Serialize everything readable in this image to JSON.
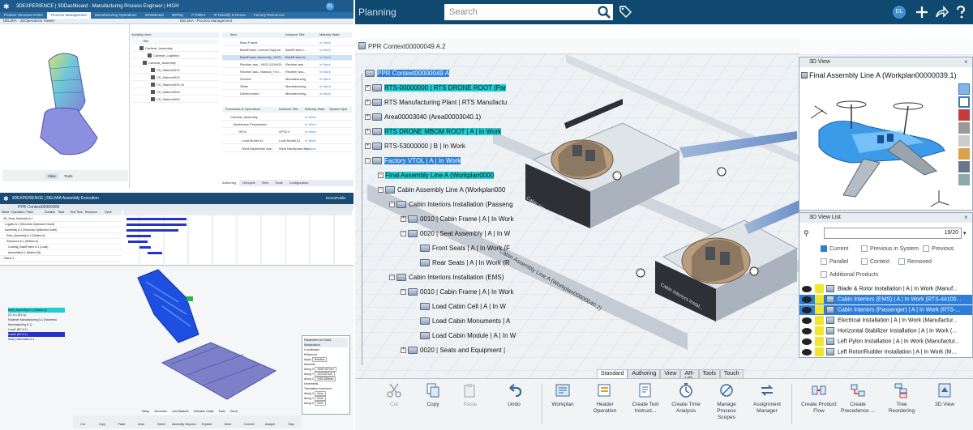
{
  "left_collage": {
    "top_app": {
      "title": "3DEXPERIENCE | 3DDashboard - Manufacturing Process Engineer | HIGH",
      "tabs": [
        "Product Structure Editor",
        "Process Management",
        "Manufacturing Operations",
        "3DWebcast",
        "3DPlay",
        "P-FMEA",
        "IP Classify & Reuse",
        "Factory Resources"
      ],
      "active_tab": 1,
      "panes": [
        "DELMIA - 3DOperations Viewer",
        "DELMIA - Process Management"
      ],
      "avatar": "DL",
      "view_tabs": [
        "View",
        "Tools"
      ],
      "table_tabs": [
        "Authoring",
        "Lifecycle",
        "View",
        "Tools",
        "Configuration"
      ],
      "tree_header": "Auxiliary view",
      "tree_col": "Title",
      "tree": [
        "Carbeat_Assembly",
        "Carbeat_Logistics",
        "Carbeat_Assembly",
        "C5_Station0010",
        "C5_Station0020",
        "C5_Station0030 v4",
        "C5_Station0040",
        "C5_Station0050"
      ],
      "grid_cols": [
        "Item",
        "Instance Title",
        "Maturity State"
      ],
      "grid_rows": [
        [
          "Back Frame",
          "",
          "In Work"
        ],
        [
          "BackFrame Lumbar Support",
          "BackFrame L...",
          "In Work"
        ],
        [
          "BackFrame Assembly_YAGI...",
          "BackFrame A...",
          "In Work"
        ],
        [
          "Recliner ass...YAGI-1110400...",
          "Recliner ass...",
          "In Work"
        ],
        [
          "Recliner ass...Manual_YGI...",
          "Recliner ass...",
          "In Work"
        ],
        [
          "Shooter",
          "Manufacturing",
          "In Work"
        ],
        [
          "Slider",
          "Manufacturing",
          "In Work"
        ],
        [
          "Dishmounted",
          "Manufacturing",
          "In Work"
        ]
      ],
      "ops_cols": [
        "Processes & Operations",
        "Instance Title",
        "Maturity State",
        "System Upd"
      ],
      "ops_rows": [
        [
          "Carbeat_Assembly",
          "",
          "In Work"
        ],
        [
          "Backframe Preparation",
          "",
          "In Work"
        ],
        [
          "OP10",
          "OP10.0",
          "In Work"
        ],
        [
          "Load Model A1",
          "Load Model A1",
          "In Work"
        ],
        [
          "Weld Backframe Ass...",
          "Weld Backframe Ass...",
          "In Work"
        ]
      ]
    },
    "bottom_app": {
      "title": "3DEXPERIENCE | DELMIA Assembly Execution",
      "context": "PPR Context00000009",
      "user": "DemoPublic",
      "grid_cols": [
        "Name / Operation / Plant",
        "Duration",
        "Start",
        "End Time",
        "Resource",
        "Cycle"
      ],
      "rows": [
        "3D_Seat_Assembly A.1",
        "Logistic A.1 (Seconds Optimized Gantt)",
        "Assembly A.1 (Seconds Optimized Gantt)",
        "Seat_Assembly A.1 (Station A)",
        "Sequence A.1 (Station A)",
        "Loading_BackFrame A.1 (Load)",
        "Assemble(A.1 (Station B))",
        "Total A.1"
      ],
      "tree": [
        "Seat_Assembly A.1 (Station A)",
        "SC A.1 (BV A)",
        "Fastener Manufacturing A.1 (Fastened Manufacturing A.1)",
        "Load1 (BV A.1)",
        "Load2 (BV A.1)",
        "Seat_Fabrication A.1"
      ],
      "robot_panel": {
        "title": "Parameters for Robot Manipulation",
        "sections": [
          "Coordinates",
          "Reference",
          "Apply",
          "Absolute",
          "Increments"
        ],
        "apply_value": "Relative",
        "fields": [
          [
            "Along X",
            "1535.097mm"
          ],
          [
            "Along Y",
            "1219.87mm"
          ],
          [
            "Along Z",
            "1952.889mm"
          ],
          [
            "Along X",
            "0mm"
          ],
          [
            "Along Y",
            "0mm"
          ],
          [
            "Along Z",
            "0mm"
          ]
        ],
        "translation_label": "Translation Increment"
      },
      "bottom_tabs": [
        "Setup",
        "Simulation",
        "Line Balance",
        "Selection Guide",
        "Tools",
        "Touch"
      ],
      "bottom_tools": [
        "Cut",
        "Copy",
        "Paste",
        "Undo",
        "Select",
        "Assembly Sequence",
        "Explode",
        "Move",
        "Connect",
        "Analyze",
        "Stop"
      ]
    }
  },
  "right_app": {
    "title": "Planning",
    "search_placeholder": "Search",
    "avatar": "DL",
    "ppr_title": "PPR Context00000049 A.2",
    "tree": [
      {
        "label": "PPR Context00000049 A",
        "hl": "blue"
      },
      {
        "label": "RTS-00000000 | RTS DRONE ROOT (Par",
        "hl": "cyan"
      },
      {
        "label": "RTS Manufacturing Plant | RTS Manufactu",
        "hl": ""
      },
      {
        "label": "Area00003040 (Area00003040.1)",
        "hl": ""
      },
      {
        "label": "RTS DRONE MBOM ROOT | A | In Work",
        "hl": "cyan"
      },
      {
        "label": "RTS-53000000 | B | In Work",
        "hl": ""
      },
      {
        "label": "Factory VTOL | A | In Work",
        "hl": "blue"
      },
      {
        "label": "Final Assembly Line A (Workplan0000",
        "hl": "cyan"
      },
      {
        "label": "Cabin Assembly Line A (Workplan000",
        "hl": ""
      },
      {
        "label": "Cabin Interiors Installation (Passeng",
        "hl": ""
      },
      {
        "label": "0010 | Cabin Frame | A | In Work",
        "hl": ""
      },
      {
        "label": "0020 | Seat Assembly | A | In W",
        "hl": ""
      },
      {
        "label": "Front Seats | A | In Work (F",
        "hl": ""
      },
      {
        "label": "Rear Seats | A | In Work (R",
        "hl": ""
      },
      {
        "label": "Cabin Interiors Installation (EMS)",
        "hl": ""
      },
      {
        "label": "0010 | Cabin Frame | A | In Work",
        "hl": ""
      },
      {
        "label": "Load Cabin Cell | A | In W",
        "hl": ""
      },
      {
        "label": "Load Cabin Monuments | A",
        "hl": ""
      },
      {
        "label": "Load Cabin Module | A | In W",
        "hl": ""
      },
      {
        "label": "0020 | Seats and Equipment |",
        "hl": ""
      }
    ],
    "floor_labels": [
      "Cabin Interiors Instal...",
      "Cabin Interiors Instal...",
      "Cabin Assembly Line A (Workplan00000040.2)"
    ],
    "view3d": {
      "header": "3D View",
      "title": "Final Assembly Line A (Workplan00000039.1)"
    },
    "view_list": {
      "header": "3D View List",
      "counter": "19/20",
      "options": [
        {
          "label": "Current",
          "checked": true
        },
        {
          "label": "Previous in System",
          "checked": false
        },
        {
          "label": "Previous",
          "checked": false
        },
        {
          "label": "Parallel",
          "checked": false
        },
        {
          "label": "Context",
          "checked": false
        },
        {
          "label": "Removed",
          "checked": false
        },
        {
          "label": "Additional Products",
          "checked": false
        }
      ],
      "rows": [
        {
          "label": "Blade & Rotor Installation | A | In Work (Manuf...",
          "selected": false
        },
        {
          "label": "Cabin Interiors (EMS) | A | In Work (RTS-44100...",
          "selected": true
        },
        {
          "label": "Cabin Interiors (Passenger) | A | In Work (RTS-...",
          "selected": true
        },
        {
          "label": "Electrical Installation | A | In Work (Manufactur...",
          "selected": false
        },
        {
          "label": "Horizontal Stabilizer Installation | A | In Work (...",
          "selected": false
        },
        {
          "label": "Left Pylon Installation | A | In Work (Manufactur...",
          "selected": false
        },
        {
          "label": "Left Rotor/Rudder Installation | A | In Work (M...",
          "selected": false
        }
      ]
    },
    "tabs": [
      "Standard",
      "Authoring",
      "View",
      "AR-VR",
      "Tools",
      "Touch"
    ],
    "active_tab": 0,
    "tools": [
      {
        "label": "Cut",
        "disabled": true
      },
      {
        "label": "Copy",
        "disabled": false
      },
      {
        "label": "Paste",
        "disabled": true
      },
      {
        "label": "Undo",
        "disabled": false
      },
      {
        "label": "Workplan",
        "disabled": false
      },
      {
        "label": "Header Operation",
        "disabled": false
      },
      {
        "label": "Create Text Instruct...",
        "disabled": false
      },
      {
        "label": "Create Time Analysis",
        "disabled": false
      },
      {
        "label": "Manage Process Scopes",
        "disabled": false
      },
      {
        "label": "Assignment Manager",
        "disabled": false
      },
      {
        "label": "Create Product Flow",
        "disabled": false
      },
      {
        "label": "Create Precedence ...",
        "disabled": false
      },
      {
        "label": "Tree Reordering",
        "disabled": false
      },
      {
        "label": "3D View",
        "disabled": false
      }
    ],
    "colors": {
      "header": "#10496f",
      "cyan_highlight": "#1fcfd1",
      "blue_highlight": "#2b7fd8",
      "visibility_yellow": "#f2e62b"
    }
  }
}
